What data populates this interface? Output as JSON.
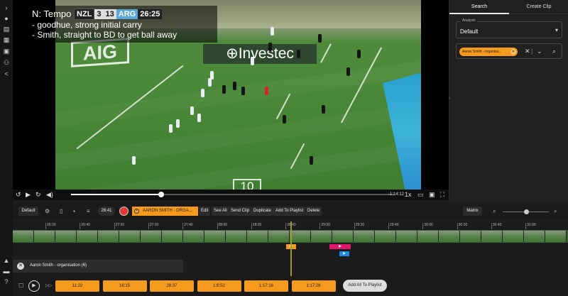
{
  "left_rail": {
    "icons": [
      "expand-icon",
      "help-icon",
      "layers-icon",
      "calendar-icon",
      "library-icon",
      "team-icon",
      "share-icon",
      "graduation-icon",
      "chat-icon",
      "question-icon"
    ]
  },
  "video": {
    "overlay": {
      "title": "N: Tempo",
      "team_home": "NZL",
      "score_home": "3",
      "score_away": "13",
      "team_away": "ARG",
      "clock": "26:25",
      "note_1": "- goodhue, strong initial carry",
      "note_2": "- Smith, straight to BD to get ball away"
    },
    "board_aig": "AIG",
    "board_investec": "⊕Investec",
    "pitch_marking": "10",
    "controls": {
      "time": "-1:14:12",
      "speed": "1x",
      "progress": 0.28
    }
  },
  "right_panel": {
    "tab_search": "Search",
    "tab_create": "Create Clip",
    "analysis_label": "Analysis",
    "analysis_value": "Default",
    "chip_label": "Aaron Smith - organisa..."
  },
  "toolbar": {
    "default_label": "Default",
    "time": "28:41",
    "clip_tag": "AARON SMITH - ORGA...",
    "edit": "Edit",
    "see_all": "See All",
    "send_clip": "Send Clip",
    "duplicate": "Duplicate",
    "add_to_playlist": "Add To Playlist",
    "delete": "Delete",
    "matrix": "Matrix",
    "zoom_level": 0.5
  },
  "timeline": {
    "ruler_labels": [
      "26:20",
      "26:40",
      "27:00",
      "27:20",
      "27:40",
      "28:00",
      "28:20",
      "28:40",
      "29:00",
      "29:20",
      "29:40",
      "30:00",
      "30:20",
      "30:40",
      "31:00"
    ],
    "playhead_time": "28:41",
    "markers": [
      {
        "color": "#f59a1c",
        "icon": "▶"
      },
      {
        "color": "#e0176f",
        "icon": "▶"
      },
      {
        "color": "#1e88e5",
        "icon": "▶"
      }
    ]
  },
  "playlist": {
    "title": "Aaron Smith - organisation (6)",
    "clips": [
      "11:22",
      "16:15",
      "28:37",
      "1:6:52",
      "1:17:16",
      "1:17:28"
    ],
    "add_all": "Add All To Playlist"
  }
}
